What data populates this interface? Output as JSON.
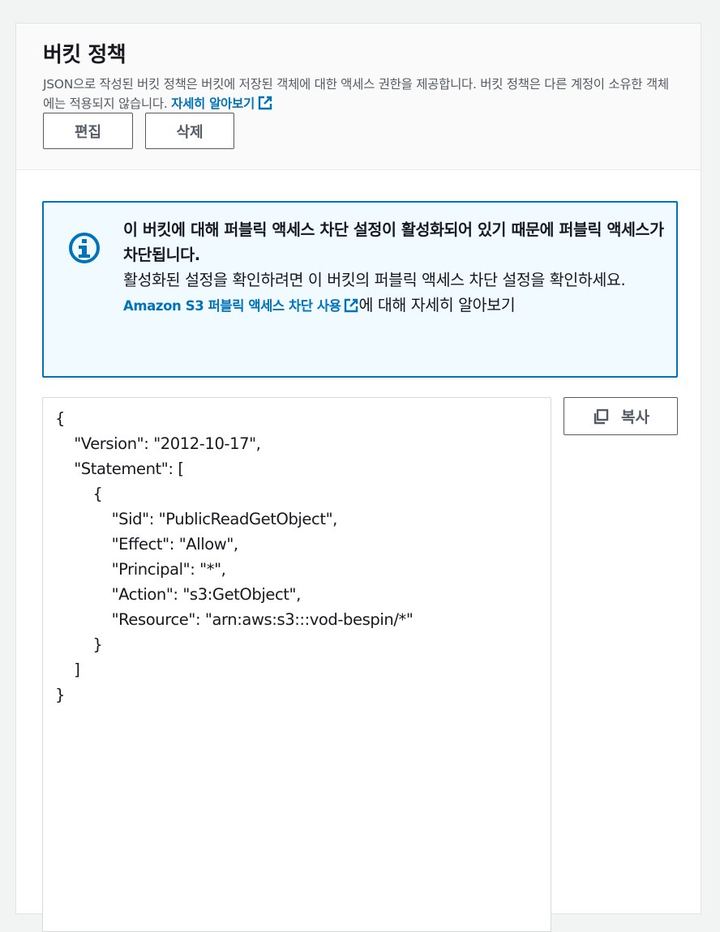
{
  "section": {
    "title": "버킷 정책",
    "description": "JSON으로 작성된 버킷 정책은 버킷에 저장된 객체에 대한 액세스 권한을 제공합니다. 버킷 정책은 다른 계정이 소유한 객체에는 적용되지 않습니다.",
    "learn_more_link": "자세히 알아보기",
    "edit_label": "편집",
    "delete_label": "삭제"
  },
  "alert": {
    "title": "이 버킷에 대해 퍼블릭 액세스 차단 설정이 활성화되어 있기 때문에 퍼블릭 액세스가 차단됩니다.",
    "body_before_link": "활성화된 설정을 확인하려면 이 버킷의 퍼블릭 액세스 차단 설정을 확인하세요.",
    "link_text": "Amazon S3 퍼블릭 액세스 차단 사용",
    "body_after_link": "에 대해 자세히 알아보기",
    "icon": "info-icon"
  },
  "policy": {
    "json_text": "{\n    \"Version\": \"2012-10-17\",\n    \"Statement\": [\n        {\n            \"Sid\": \"PublicReadGetObject\",\n            \"Effect\": \"Allow\",\n            \"Principal\": \"*\",\n            \"Action\": \"s3:GetObject\",\n            \"Resource\": \"arn:aws:s3:::vod-bespin/*\"\n        }\n    ]\n}",
    "copy_label": "복사"
  },
  "colors": {
    "link": "#0073bb",
    "alert_border": "#0073bb",
    "alert_bg": "#f1faff",
    "button_border": "#545b64"
  }
}
